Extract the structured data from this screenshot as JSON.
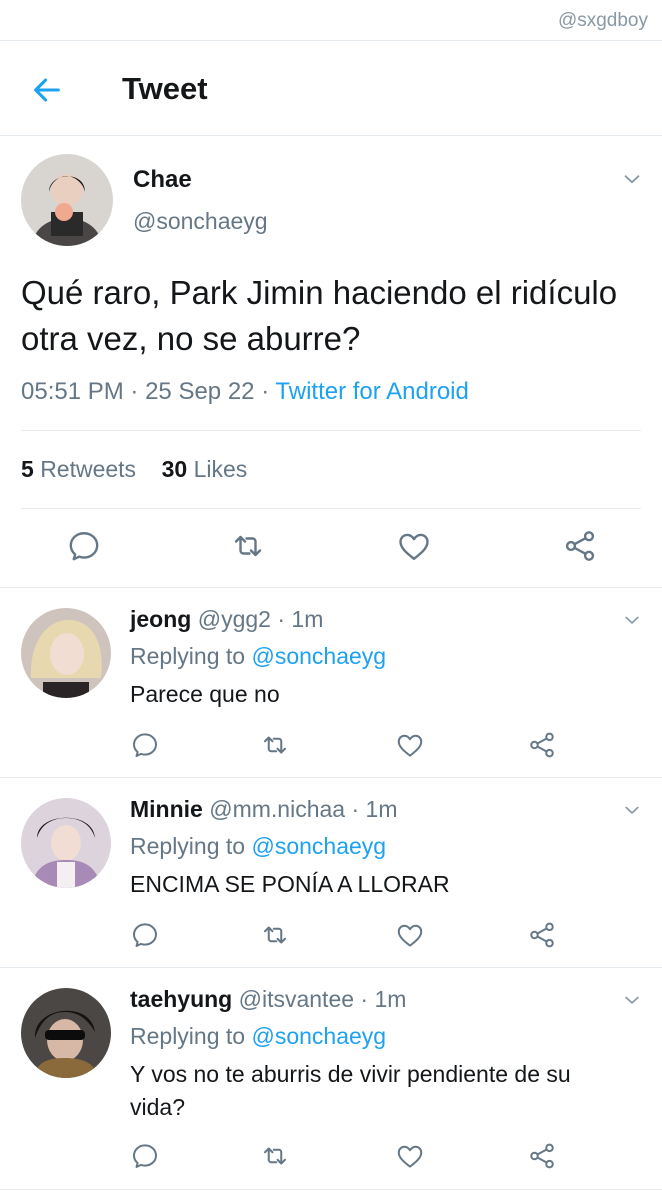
{
  "watermark": "@sxgdboy",
  "header": {
    "title": "Tweet"
  },
  "tweet": {
    "name": "Chae",
    "handle": "@sonchaeyg",
    "text": "Qué raro, Park Jimin haciendo el ridículo otra vez, no se aburre?",
    "time": "05:51 PM",
    "date": "25 Sep 22",
    "sep1": "·",
    "sep2": "·",
    "source": "Twitter for Android",
    "retweets_count": "5",
    "retweets_label": "Retweets",
    "likes_count": "30",
    "likes_label": "Likes"
  },
  "replies": [
    {
      "name": "jeong",
      "handle": "@ygg2",
      "dot": "·",
      "time": "1m",
      "replying_prefix": "Replying to",
      "replying_to": "@sonchaeyg",
      "text": "Parece que no"
    },
    {
      "name": "Minnie",
      "handle": "@mm.nichaa",
      "dot": "·",
      "time": "1m",
      "replying_prefix": "Replying to",
      "replying_to": "@sonchaeyg",
      "text": "ENCIMA SE PONÍA A LLORAR"
    },
    {
      "name": "taehyung",
      "handle": "@itsvantee",
      "dot": "·",
      "time": "1m",
      "replying_prefix": "Replying to",
      "replying_to": "@sonchaeyg",
      "text": "Y vos no te aburris de vivir pendiente de su vida?"
    }
  ],
  "colors": {
    "accent": "#1da1f2",
    "secondary_text": "#657786",
    "icon": "#657786",
    "divider": "#e6ecf0"
  },
  "icons": [
    "back-arrow-icon",
    "chevron-down-icon",
    "reply-icon",
    "retweet-icon",
    "like-icon",
    "share-icon"
  ]
}
